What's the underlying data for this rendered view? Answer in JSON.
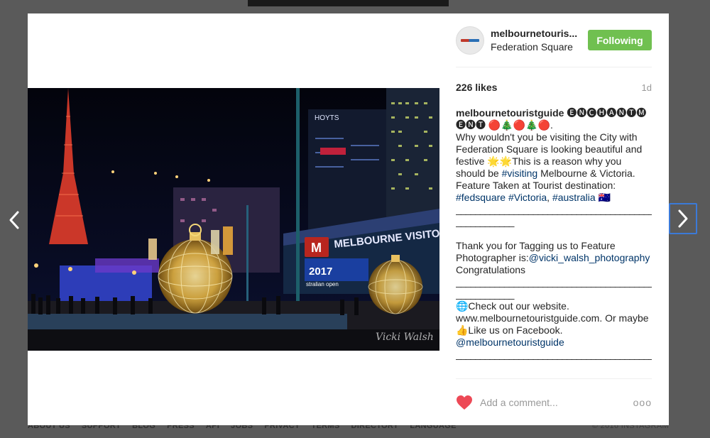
{
  "footer": {
    "links": [
      "ABOUT US",
      "SUPPORT",
      "BLOG",
      "PRESS",
      "API",
      "JOBS",
      "PRIVACY",
      "TERMS",
      "DIRECTORY",
      "LANGUAGE"
    ],
    "copyright": "© 2016 INSTAGRAM"
  },
  "nav": {
    "prev_icon": "chevron-left-icon",
    "next_icon": "chevron-right-icon"
  },
  "post": {
    "username_short": "melbournetouris...",
    "location": "Federation Square",
    "follow_label": "Following",
    "likes": "226 likes",
    "age": "1d",
    "caption": {
      "username": "melbournetouristguide",
      "title_line1": "🅔🅝🅒🅗🅐🅝🅣🅜",
      "title_line2": "🅔🅝🅣 🔴🎄🔴🎄🔴.",
      "text1": "Why wouldn't you be visiting the City with Federation Square is looking beautiful and festive 🌟🌟This is a reason why you should be ",
      "tag_visiting": "#visiting",
      "text2": " Melbourne & Victoria. Feature Taken at Tourist destination: ",
      "tag_fedsquare": "#fedsquare",
      "tag_victoria": "#Victoria",
      "sep1": ", ",
      "tag_australia": "#australia",
      "flag": " 🇦🇺",
      "rule": "__________________________________________________",
      "thanks": "Thank you for Tagging us to Feature Photographer is:",
      "photographer": "@vicki_walsh_photography",
      "congrats": "Congratulations",
      "website": "🌐Check out our website. www.melbournetouristguide.com. Or maybe 👍Like us on Facebook.",
      "mention": "@melbournetouristguide"
    },
    "comment_placeholder": "Add a comment...",
    "more_label": "ooo"
  },
  "photo": {
    "signs": [
      "MELBOURNE VISITOR C",
      "2017",
      "stralian open",
      "HOYTS"
    ],
    "signature": "Vicki Walsh"
  },
  "colors": {
    "follow": "#70c050",
    "link": "#003569",
    "heart": "#ed4956",
    "backdrop": "#5a5a5a"
  }
}
